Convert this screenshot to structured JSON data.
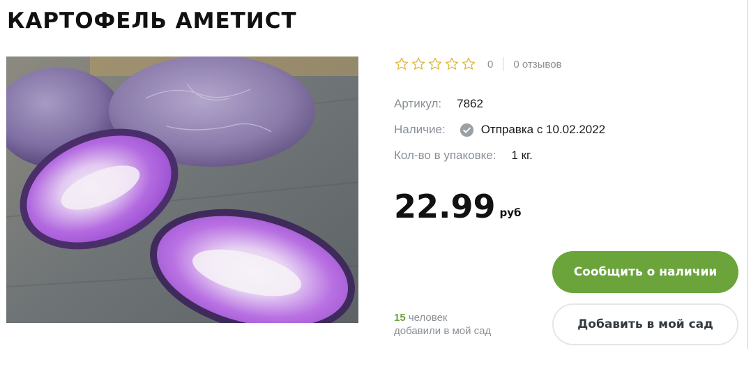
{
  "product": {
    "title": "КАРТОФЕЛЬ АМЕТИСТ",
    "image_alt": "Purple potatoes, two halves cut showing violet flesh",
    "rating": {
      "stars_total": 5,
      "stars_filled": 0,
      "count": "0",
      "reviews_label": "0 отзывов"
    },
    "details": {
      "sku_label": "Артикул:",
      "sku_value": "7862",
      "stock_label": "Наличие:",
      "stock_value": "Отправка с 10.02.2022",
      "pack_label": "Кол-во в упаковке:",
      "pack_value": "1 кг."
    },
    "price": {
      "value": "22.99",
      "currency": "руб"
    },
    "actions": {
      "notify_label": "Сообщить о наличии",
      "add_garden_label": "Добавить в мой сад"
    },
    "garden_counter": {
      "count": "15",
      "line1_suffix": " человек",
      "line2": "добавили в мой сад"
    }
  },
  "icons": {
    "star": "star-outline-icon",
    "stock": "check-circle-icon"
  },
  "colors": {
    "accent_green": "#6aa43b",
    "star_outline": "#e0b53a",
    "muted_text": "#8a9096",
    "check_circle": "#9aa0a4"
  }
}
